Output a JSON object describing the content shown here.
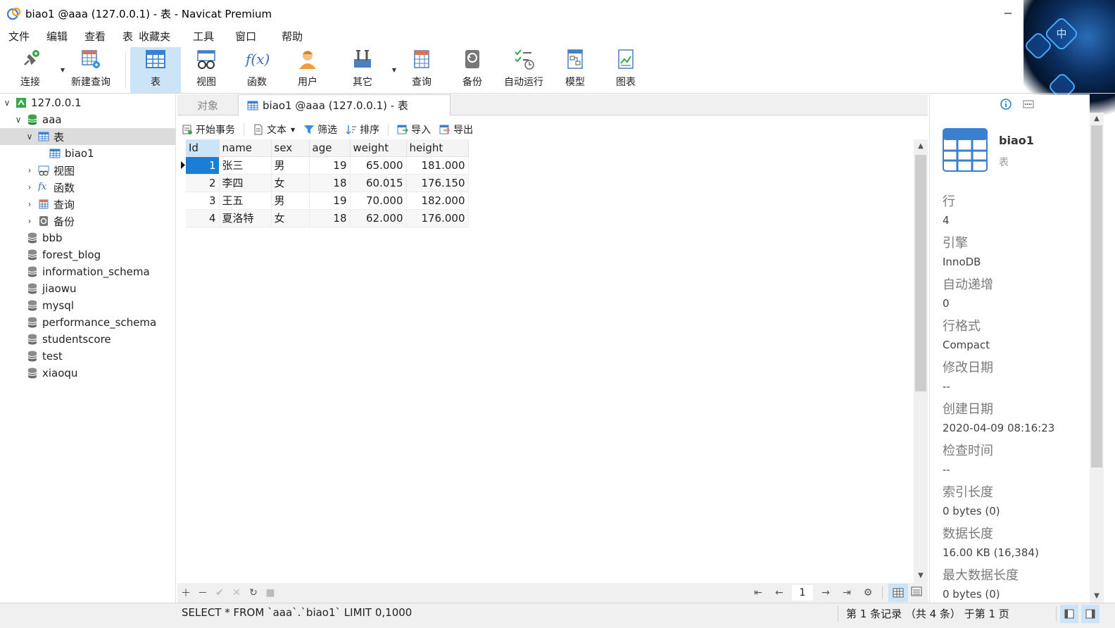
{
  "window": {
    "title": "biao1 @aaa (127.0.0.1) - 表 - Navicat Premium",
    "deco_char": "中"
  },
  "menu": [
    "文件",
    "编辑",
    "查看",
    "表",
    "收藏夹",
    "工具",
    "窗口",
    "帮助"
  ],
  "toolbar": {
    "connect": "连接",
    "new_query": "新建查询",
    "table": "表",
    "view": "视图",
    "function": "函数",
    "user": "用户",
    "others": "其它",
    "query": "查询",
    "backup": "备份",
    "automation": "自动运行",
    "model": "模型",
    "chart": "图表",
    "function_glyph": "f(x)",
    "active": "table"
  },
  "tree": {
    "connection": "127.0.0.1",
    "database": "aaa",
    "tables_node": "表",
    "table_item": "biao1",
    "views_node": "视图",
    "functions_node": "函数",
    "queries_node": "查询",
    "backups_node": "备份",
    "function_glyph": "fx",
    "other_databases": [
      "bbb",
      "forest_blog",
      "information_schema",
      "jiaowu",
      "mysql",
      "performance_schema",
      "studentscore",
      "test",
      "xiaoqu"
    ]
  },
  "tabs": {
    "objects": "对象",
    "active_tab": "biao1 @aaa (127.0.0.1) - 表"
  },
  "subtoolbar": {
    "begin_transaction": "开始事务",
    "text": "文本",
    "filter": "筛选",
    "sort": "排序",
    "import": "导入",
    "export": "导出"
  },
  "grid": {
    "columns": [
      "Id",
      "name",
      "sex",
      "age",
      "weight",
      "height"
    ],
    "rows": [
      [
        "1",
        "张三",
        "男",
        "19",
        "65.000",
        "181.000"
      ],
      [
        "2",
        "李四",
        "女",
        "18",
        "60.015",
        "176.150"
      ],
      [
        "3",
        "王五",
        "男",
        "19",
        "70.000",
        "182.000"
      ],
      [
        "4",
        "夏洛特",
        "女",
        "18",
        "62.000",
        "176.000"
      ]
    ],
    "selected_row": 0
  },
  "gridnav": {
    "page": "1"
  },
  "status": {
    "sql": "SELECT * FROM `aaa`.`biao1` LIMIT 0,1000",
    "record_info": "第 1 条记录 （共 4 条） 于第 1 页"
  },
  "info": {
    "name": "biao1",
    "type": "表",
    "properties": [
      {
        "label": "行",
        "value": "4"
      },
      {
        "label": "引擎",
        "value": "InnoDB"
      },
      {
        "label": "自动递增",
        "value": "0"
      },
      {
        "label": "行格式",
        "value": "Compact"
      },
      {
        "label": "修改日期",
        "value": "--"
      },
      {
        "label": "创建日期",
        "value": "2020-04-09 08:16:23"
      },
      {
        "label": "检查时间",
        "value": "--"
      },
      {
        "label": "索引长度",
        "value": "0 bytes (0)"
      },
      {
        "label": "数据长度",
        "value": "16.00 KB (16,384)"
      },
      {
        "label": "最大数据长度",
        "value": "0 bytes (0)"
      }
    ]
  },
  "colors": {
    "accent": "#1a7fd4",
    "active_tool_bg": "#cce4f7",
    "db_green": "#3aa64c"
  }
}
